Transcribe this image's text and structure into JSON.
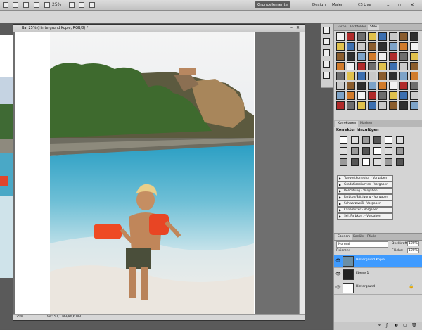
{
  "app": {
    "workspaces": [
      "Grundelemente",
      "Design",
      "Malen"
    ],
    "active_workspace": "Grundelemente",
    "cs_live": "CS Live",
    "zoom_top": "25%"
  },
  "document": {
    "tab_title": "Bal 25% (Hintergrund Kopie, RGB/8) *",
    "zoom": "25%",
    "doc_info": "Dok: 57,1 MB/90,6 MB"
  },
  "swatches_panel": {
    "tabs": [
      "Farbe",
      "Farbfelder",
      "Stile"
    ],
    "active_tab": "Stile"
  },
  "adjustments_panel": {
    "tabs": [
      "Korrekturen",
      "Masken"
    ],
    "title": "Korrektur hinzufügen",
    "presets": [
      "Tonwertkorrektur - Vorgaben",
      "Gradationskurven - Vorgaben",
      "Belichtung - Vorgaben",
      "Farbton/Sättigung - Vorgaben",
      "Schwarzweiß - Vorgaben",
      "Kanalmixer - Vorgaben",
      "Sel. Farbkorr. - Vorgaben"
    ]
  },
  "layers_panel": {
    "tabs": [
      "Ebenen",
      "Kanäle",
      "Pfade"
    ],
    "blend_mode": "Normal",
    "opacity_label": "Deckkraft:",
    "opacity": "100%",
    "lock_label": "Fixieren:",
    "fill_label": "Fläche:",
    "fill": "100%",
    "layers": [
      "Hintergrund Kopie",
      "Ebene 1",
      "Hintergrund"
    ]
  },
  "colors": {
    "selection": "#3f9bff",
    "panel": "#d4d4d4",
    "workspace": "#5a5a5a"
  }
}
